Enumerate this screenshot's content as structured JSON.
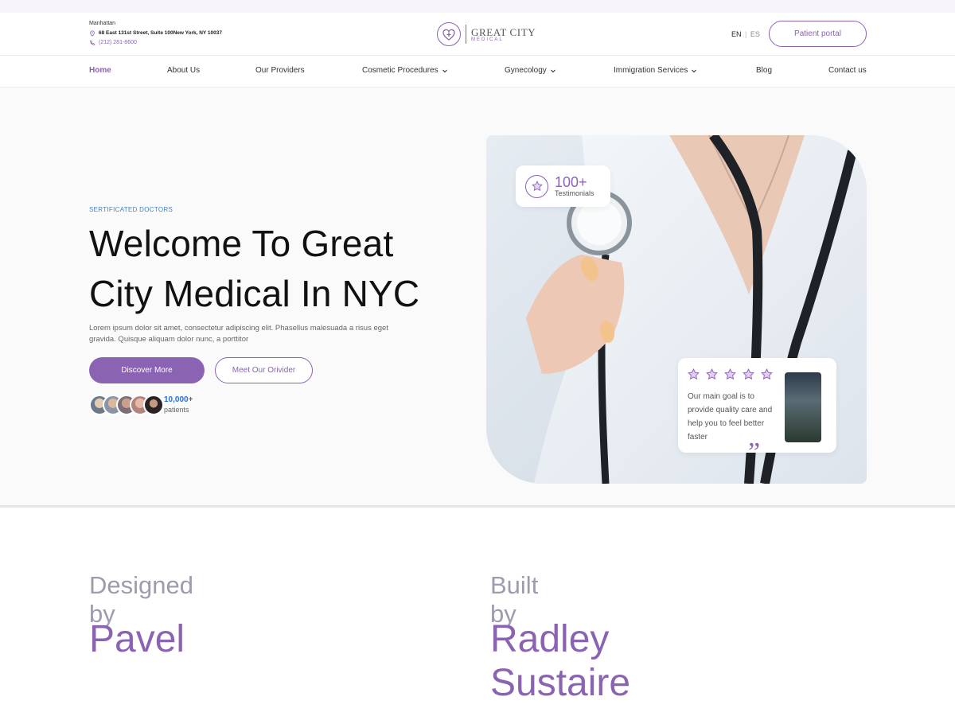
{
  "header": {
    "city": "Manhattan",
    "street": "68 East 131st Street, Suite 100New York, NY 10037",
    "phone": "(212) 281-8600",
    "logo_title": "GREAT CITY",
    "logo_subtitle": "MEDICAL",
    "lang_en": "EN",
    "lang_es": "ES",
    "portal_label": "Patient portal"
  },
  "nav": {
    "items": [
      {
        "label": "Home"
      },
      {
        "label": "About Us"
      },
      {
        "label": "Our Providers"
      },
      {
        "label": "Cosmetic Procedures"
      },
      {
        "label": "Gynecology"
      },
      {
        "label": "Immigration Services"
      },
      {
        "label": "Blog"
      },
      {
        "label": "Contact us"
      }
    ]
  },
  "hero": {
    "eyebrow": "SERTIFICATED DOCTORS",
    "headline_line1": "Welcome To Great",
    "headline_line2": "City Medical In NYC",
    "lead": "Lorem ipsum dolor sit amet, consectetur adipiscing elit. Phasellus malesuada a risus eget gravida. Quisque aliquam dolor nunc, a porttitor",
    "cta_primary": "Discover More",
    "cta_secondary": "Meet Our Orivider",
    "patients_count": "10,000+",
    "patients_label": "patients",
    "testimonials_count": "100+",
    "testimonials_label": "Testimonials",
    "review_text": "Our main goal is to provide quality care and help you to feel better faster",
    "review_stars": 5
  },
  "credits": {
    "designed_label": "Designed by",
    "designer": "Pavel",
    "built_label": "Built by",
    "builder": "Radley Sustaire"
  },
  "colors": {
    "accent": "#8b63b3",
    "link_blue": "#2a6fd6"
  }
}
